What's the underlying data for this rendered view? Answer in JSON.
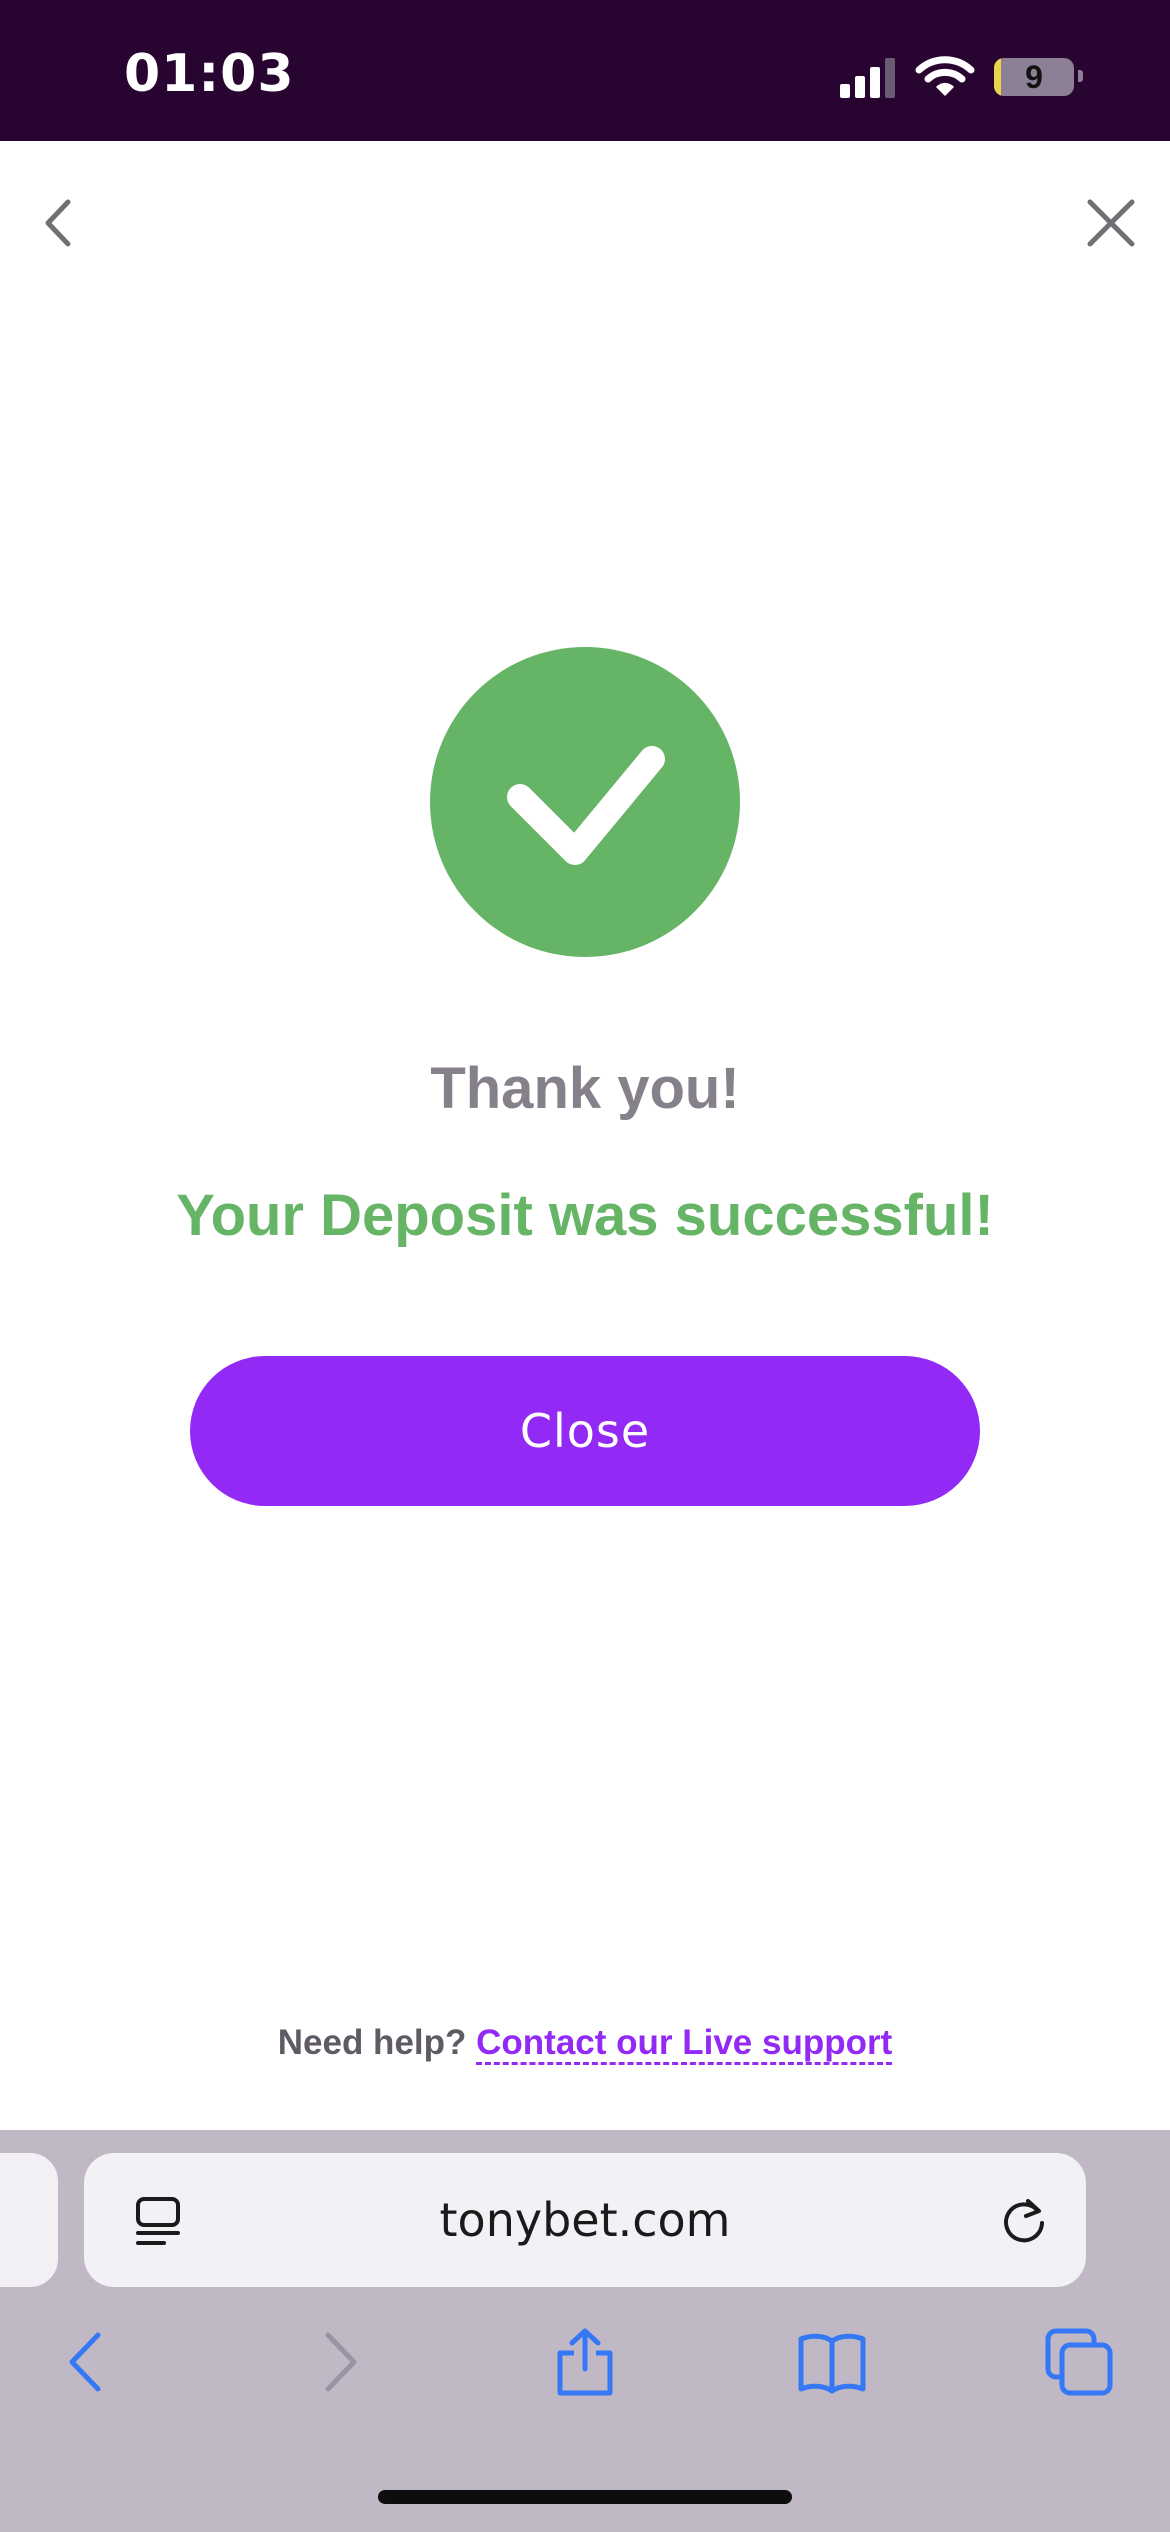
{
  "status_bar": {
    "time": "01:03",
    "battery_level": "9",
    "battery_fraction": 0.09
  },
  "navigation": {
    "back_icon": "chevron-left-icon",
    "close_icon": "close-icon"
  },
  "result": {
    "icon": "checkmark-icon",
    "title": "Thank you!",
    "message": "Your Deposit was successful!",
    "close_label": "Close"
  },
  "help": {
    "prefix": "Need help?",
    "link_text": "Contact our Live support"
  },
  "browser": {
    "url": "tonybet.com",
    "toolbar": [
      "back-icon",
      "forward-icon",
      "share-icon",
      "bookmarks-icon",
      "tabs-icon"
    ]
  },
  "colors": {
    "status_bar_bg": "#280431",
    "success_green": "#66b466",
    "brand_purple": "#9229f5",
    "title_gray": "#85808a",
    "browser_blue": "#3478f6",
    "browser_bg": "#c1b8c6"
  }
}
